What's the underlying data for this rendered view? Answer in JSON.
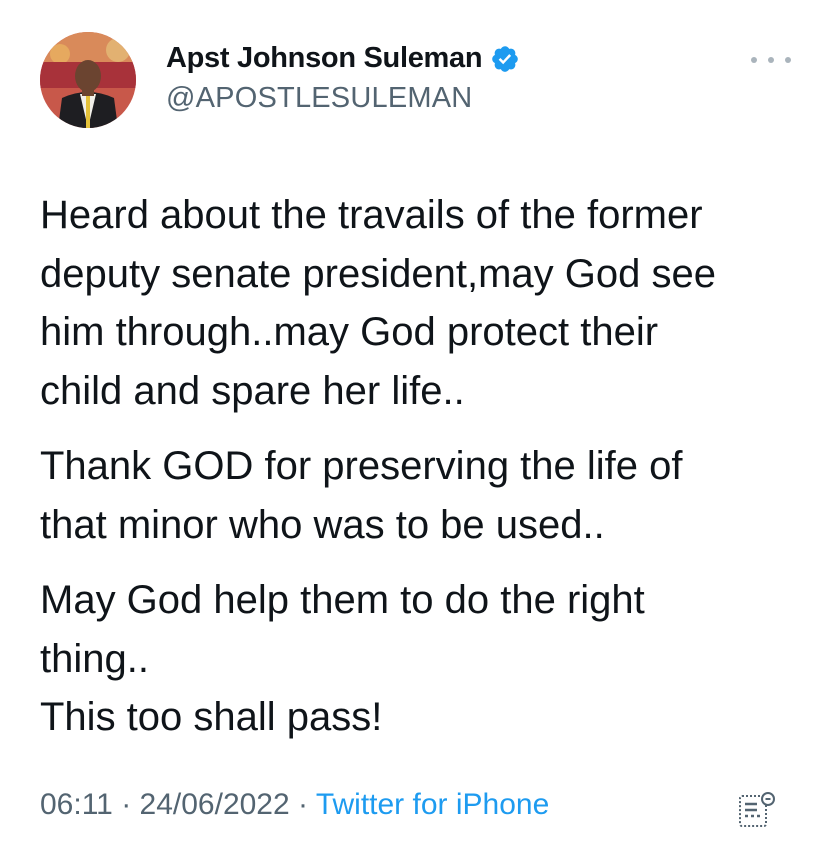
{
  "author": {
    "display_name": "Apst Johnson Suleman",
    "handle": "@APOSTLESULEMAN",
    "verified": true
  },
  "tweet": {
    "paragraphs": [
      [
        "Heard about the travails of the former",
        "deputy senate president,may God see",
        "him through..may God protect their",
        "child and spare her life.."
      ],
      [
        "Thank GOD for preserving the life of",
        "that minor who was to be used.."
      ],
      [
        "May God help them to do the right",
        "thing..",
        "This too shall pass!"
      ]
    ]
  },
  "meta": {
    "time": "06:11",
    "separator": " · ",
    "date": "24/06/2022",
    "source": "Twitter for iPhone"
  },
  "icons": {
    "verified": "verified-badge-icon",
    "more": "more-horizontal-icon",
    "analytics": "view-analytics-icon"
  },
  "colors": {
    "text": "#0f1419",
    "secondary": "#536471",
    "accent": "#1d9bf0"
  }
}
